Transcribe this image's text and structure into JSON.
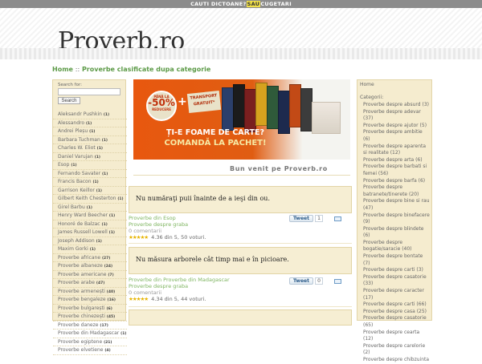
{
  "topbar": {
    "left": "CAUTI DICTOANE?",
    "sep": "SAU",
    "right": "CUGETARI"
  },
  "logo": "Proverb.ro",
  "breadcrumb": {
    "home": "Home",
    "sep": "::",
    "current": "Proverbe clasificate dupa categorie"
  },
  "search": {
    "label": "Search for:",
    "value": "",
    "button": "Search"
  },
  "authors": [
    {
      "name": "Aleksandr Pushkin",
      "count": "(1)"
    },
    {
      "name": "Alessandro",
      "count": "(1)"
    },
    {
      "name": "Andrei Pleșu",
      "count": "(1)"
    },
    {
      "name": "Barbara Tuchman",
      "count": "(1)"
    },
    {
      "name": "Charles W. Eliot",
      "count": "(1)"
    },
    {
      "name": "Daniel Varujan",
      "count": "(1)"
    },
    {
      "name": "Esop",
      "count": "(1)"
    },
    {
      "name": "Fernando Savater",
      "count": "(1)"
    },
    {
      "name": "Francis Bacon",
      "count": "(1)"
    },
    {
      "name": "Garrison Keillor",
      "count": "(1)"
    },
    {
      "name": "Gilbert Keith Chesterton",
      "count": "(1)"
    },
    {
      "name": "Girel Barbu",
      "count": "(1)"
    },
    {
      "name": "Henry Ward Beecher",
      "count": "(1)"
    },
    {
      "name": "Honoré de Balzac",
      "count": "(1)"
    },
    {
      "name": "James Russell Lowell",
      "count": "(1)"
    },
    {
      "name": "Joseph Addison",
      "count": "(1)"
    },
    {
      "name": "Maxim Gorki",
      "count": "(1)"
    },
    {
      "name": "Proverbe africane",
      "count": "(27)"
    },
    {
      "name": "Proverbe albaneze",
      "count": "(24)"
    },
    {
      "name": "Proverbe americane",
      "count": "(7)"
    },
    {
      "name": "Proverbe arabe",
      "count": "(47)"
    },
    {
      "name": "Proverbe armenești",
      "count": "(40)"
    },
    {
      "name": "Proverbe bengaleze",
      "count": "(16)"
    },
    {
      "name": "Proverbe bulgarești",
      "count": "(6)"
    },
    {
      "name": "Proverbe chinezești",
      "count": "(45)"
    },
    {
      "name": "Proverbe daneze",
      "count": "(17)"
    },
    {
      "name": "Proverbe din Madagascar",
      "count": "(1)"
    },
    {
      "name": "Proverbe egiptene",
      "count": "(21)"
    },
    {
      "name": "Proverbe elvetiene",
      "count": "(4)"
    }
  ],
  "banner": {
    "badge_top": "PÂNĂ LA",
    "badge_value": "-50%",
    "badge_bottom": "REDUCERE",
    "plus": "+",
    "free_line1": "TRANSPORT",
    "free_line2": "GRATUIT*",
    "tagline1": "ȚI-E FOAME DE CARTE?",
    "tagline2": "COMANDĂ LA PACHET!",
    "book_colors": [
      "#2b3f6b",
      "#1b1b1b",
      "#7a1f1f",
      "#d6a21e",
      "#2f5a3a",
      "#1d2a4e",
      "#c24a16",
      "#3c3c3c"
    ]
  },
  "welcome": "Bun venit pe Proverb.ro",
  "quotes": [
    {
      "text": "Nu număraţi puii înainte de a ieşi din ou.",
      "category1": "Proverbe din Esop",
      "category2": "Proverbe despre graba",
      "comments": "0 comentarii",
      "stars": "★★★★★",
      "rating": "4.36 din 5, 50 voturi.",
      "tweet": "Tweet",
      "tweet_count": "1"
    },
    {
      "text": "Nu măsura arborele cât timp mai e în picioare.",
      "category1": "Proverbe din Proverbe din Madagascar",
      "category2": "Proverbe despre graba",
      "comments": "0 comentarii",
      "stars": "★★★★★",
      "rating": "4.34 din 5, 44 voturi.",
      "tweet": "Tweet",
      "tweet_count": "0"
    }
  ],
  "right_sidebar": {
    "home": "Home",
    "categories_title": "Categorii:",
    "categories": [
      "Proverbe despre absurd (3)",
      "Proverbe despre adevar (37)",
      "Proverbe despre ajutor (5)",
      "Proverbe despre ambitie (6)",
      "Proverbe despre aparenta si realitate (12)",
      "Proverbe despre arta (6)",
      "Proverbe despre barbati si femei (56)",
      "Proverbe despre barfa (6)",
      "Proverbe despre batranete/tinerete (20)",
      "Proverbe despre bine si rau (47)",
      "Proverbe despre binefacere (9)",
      "Proverbe despre blindete (6)",
      "Proverbe despre bogatie/saracie (40)",
      "Proverbe despre bontate (7)",
      "Proverbe despre carti (3)",
      "Proverbe despre casatorie (33)",
      "Proverbe despre caracter (17)",
      "Proverbe despre carti (66)",
      "Proverbe despre casa (25)",
      "Proverbe despre casatorie (65)",
      "Proverbe despre cearta (12)",
      "Proverbe despre carelorie (2)",
      "Proverbe despre chibzuinta"
    ]
  }
}
